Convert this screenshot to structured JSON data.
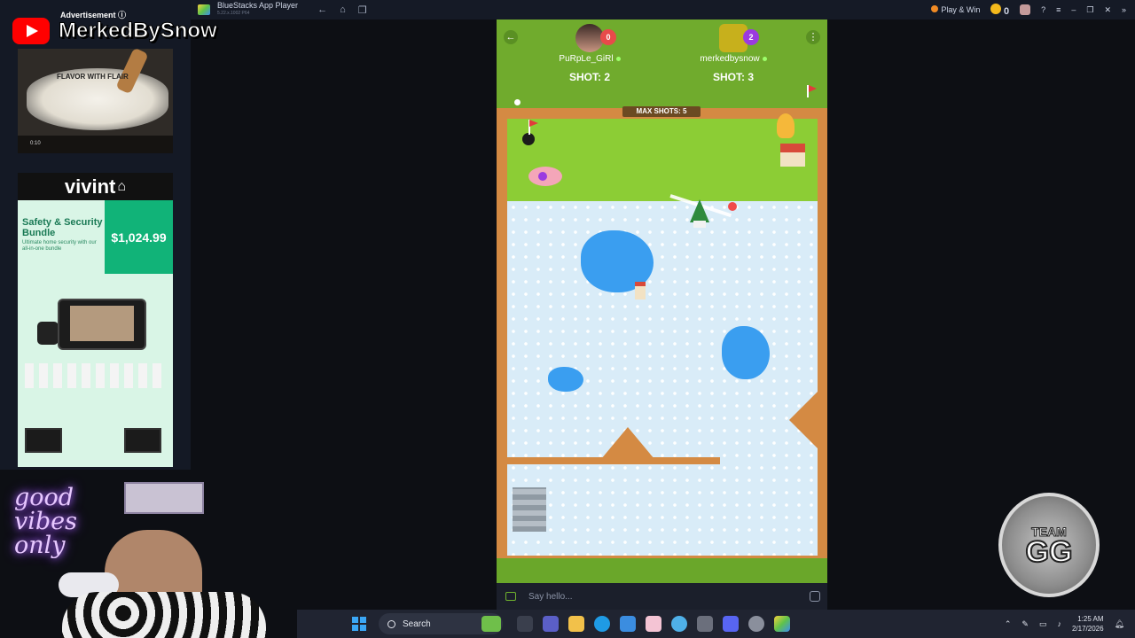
{
  "bluestacks": {
    "title": "BlueStacks App Player",
    "subtitle": "5.22.x.1002 P64",
    "play_win": "Play & Win",
    "coins": "0"
  },
  "stream": {
    "channel_name": "MerkedBySnow"
  },
  "ad_panel": {
    "label": "Advertisement ⓘ",
    "video_caption": "FLAVOR WITH FLAIR",
    "video_time": "0:10",
    "vivint_logo": "vivint",
    "vivint_headline": "Safety & Security Bundle",
    "vivint_subtext": "Ultimate home security with our all-in-one bundle",
    "vivint_price": "$1,024.99"
  },
  "webcam": {
    "neon_text": "good vibes only"
  },
  "game": {
    "player1": {
      "name": "PuRpLe_GiRl",
      "score": "0",
      "shots": "SHOT: 2",
      "badge_color": "#e84a4a"
    },
    "player2": {
      "name": "merkedbysnow",
      "score": "2",
      "shots": "SHOT: 3",
      "badge_color": "#9b3ae0"
    },
    "max_shots": "MAX SHOTS: 5",
    "colors": {
      "grass": "#8ccd35",
      "ice": "#d9ecf8",
      "water": "#3a9ef0",
      "wall": "#d48a43"
    }
  },
  "chat": {
    "placeholder": "Say hello..."
  },
  "overlay": {
    "team_line1": "TEAM",
    "team_line2": "GG"
  },
  "taskbar": {
    "search_label": "Search",
    "time": "1:25 AM",
    "date": "2/17/2026"
  }
}
